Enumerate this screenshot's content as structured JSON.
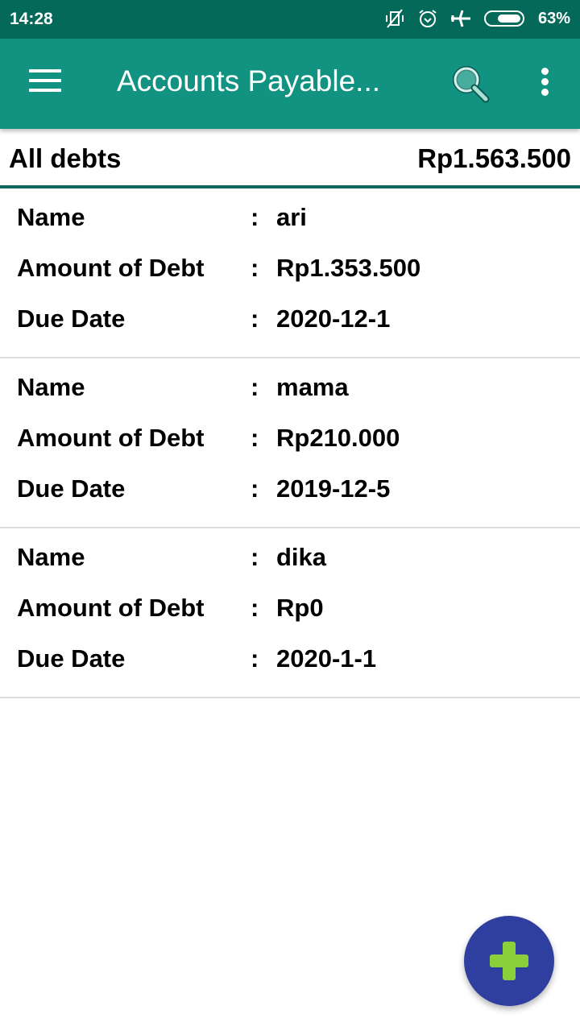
{
  "status_bar": {
    "time": "14:28",
    "battery_percent": "63%",
    "icons": [
      "vibrate-off-icon",
      "alarm-icon",
      "airplane-icon",
      "battery-icon"
    ]
  },
  "app_bar": {
    "title": "Accounts Payable...",
    "menu_icon": "hamburger-menu-icon",
    "search_icon": "search-icon",
    "more_icon": "more-vert-icon"
  },
  "summary": {
    "label": "All debts",
    "total": "Rp1.563.500"
  },
  "field_labels": {
    "name": "Name",
    "amount": "Amount of Debt",
    "due_date": "Due Date",
    "separator": ":"
  },
  "debts": [
    {
      "name": "ari",
      "amount": "Rp1.353.500",
      "due_date": "2020-12-1"
    },
    {
      "name": "mama",
      "amount": "Rp210.000",
      "due_date": "2019-12-5"
    },
    {
      "name": "dika",
      "amount": "Rp0",
      "due_date": "2020-1-1"
    }
  ],
  "fab": {
    "icon": "plus-icon",
    "accent": "#8bcf3b",
    "background": "#2f3f9f"
  },
  "colors": {
    "status_bar": "#05695a",
    "app_bar": "#129281",
    "divider": "#0d6a5c"
  }
}
